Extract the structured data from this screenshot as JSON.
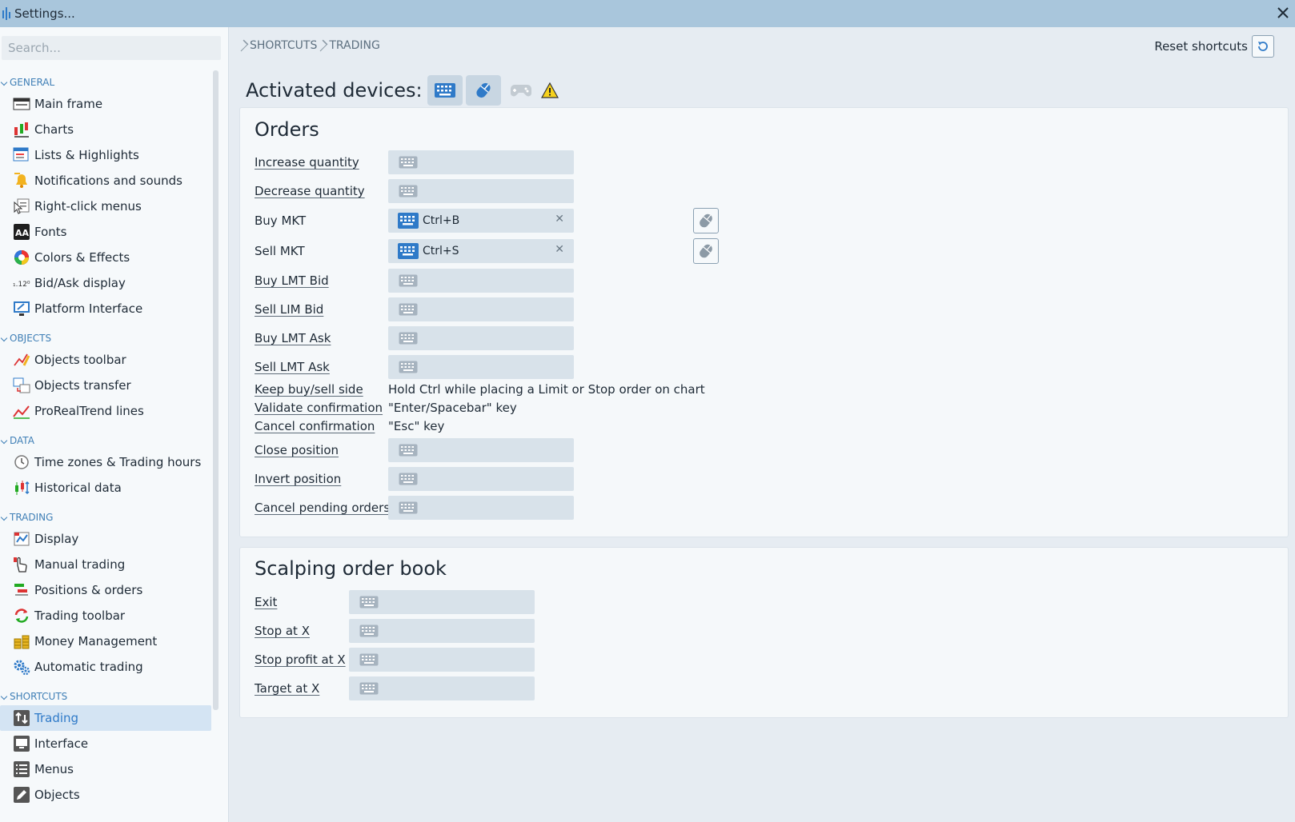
{
  "window": {
    "title": "Settings..."
  },
  "search": {
    "placeholder": "Search..."
  },
  "sidebar": {
    "sections": [
      {
        "label": "GENERAL",
        "items": [
          "Main frame",
          "Charts",
          "Lists & Highlights",
          "Notifications and sounds",
          "Right-click menus",
          "Fonts",
          "Colors & Effects",
          "Bid/Ask display",
          "Platform Interface"
        ]
      },
      {
        "label": "OBJECTS",
        "items": [
          "Objects toolbar",
          "Objects transfer",
          "ProRealTrend lines"
        ]
      },
      {
        "label": "DATA",
        "items": [
          "Time zones & Trading hours",
          "Historical data"
        ]
      },
      {
        "label": "TRADING",
        "items": [
          "Display",
          "Manual trading",
          "Positions & orders",
          "Trading toolbar",
          "Money Management",
          "Automatic trading"
        ]
      },
      {
        "label": "SHORTCUTS",
        "items": [
          "Trading",
          "Interface",
          "Menus",
          "Objects"
        ]
      }
    ],
    "active_item": "Trading"
  },
  "breadcrumb": [
    "SHORTCUTS",
    "TRADING"
  ],
  "reset_label": "Reset shortcuts",
  "activated_label": "Activated devices:",
  "orders": {
    "title": "Orders",
    "rows": {
      "increase_quantity": "Increase quantity",
      "decrease_quantity": "Decrease quantity",
      "buy_mkt": {
        "label": "Buy MKT",
        "shortcut": "Ctrl+B"
      },
      "sell_mkt": {
        "label": "Sell MKT",
        "shortcut": "Ctrl+S"
      },
      "buy_lmt_bid": "Buy LMT Bid",
      "sell_lim_bid": "Sell LIM Bid",
      "buy_lmt_ask": "Buy LMT Ask",
      "sell_lmt_ask": "Sell LMT Ask",
      "keep_side": {
        "label": "Keep buy/sell side",
        "value": "Hold Ctrl while placing a Limit or Stop order on chart"
      },
      "validate": {
        "label": "Validate confirmation",
        "value": "\"Enter/Spacebar\" key"
      },
      "cancel_conf": {
        "label": "Cancel confirmation",
        "value": "\"Esc\" key"
      },
      "close_position": "Close position",
      "invert_position": "Invert position",
      "cancel_pending": "Cancel pending orders"
    }
  },
  "scalping": {
    "title": "Scalping order book",
    "rows": {
      "exit": "Exit",
      "stop_at_x": "Stop at X",
      "stop_profit_at_x": "Stop profit at X",
      "target_at_x": "Target at X"
    }
  },
  "colors": {
    "accent": "#2f7ac8",
    "titlebar": "#a9c6dc",
    "field": "#d8e2ea"
  }
}
